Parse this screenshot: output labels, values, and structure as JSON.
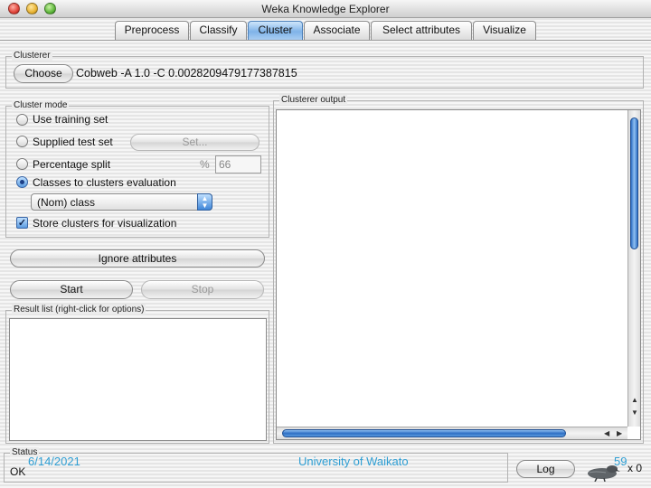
{
  "window": {
    "title": "Weka Knowledge Explorer"
  },
  "tabs": [
    {
      "label": "Preprocess",
      "active": false
    },
    {
      "label": "Classify",
      "active": false
    },
    {
      "label": "Cluster",
      "active": true
    },
    {
      "label": "Associate",
      "active": false
    },
    {
      "label": "Select attributes",
      "active": false
    },
    {
      "label": "Visualize",
      "active": false
    }
  ],
  "clusterer": {
    "title": "Clusterer",
    "choose_label": "Choose",
    "scheme": "Cobweb -A 1.0 -C 0.0028209479177387815"
  },
  "cluster_mode": {
    "title": "Cluster mode",
    "options": [
      {
        "label": "Use training set",
        "selected": false
      },
      {
        "label": "Supplied test set",
        "selected": false
      },
      {
        "label": "Percentage split",
        "selected": false
      },
      {
        "label": "Classes to clusters evaluation",
        "selected": true
      }
    ],
    "set_button": "Set...",
    "percent_symbol": "%",
    "percent_value": "66",
    "class_select": "(Nom) class",
    "store_clusters_label": "Store clusters for visualization",
    "store_clusters_checked": true
  },
  "buttons": {
    "ignore_attributes": "Ignore attributes",
    "start": "Start",
    "stop": "Stop"
  },
  "result_list": {
    "title": "Result list (right-click for options)"
  },
  "output": {
    "title": "Clusterer output"
  },
  "status": {
    "title": "Status",
    "text": "OK",
    "log_button": "Log",
    "count": "x 0"
  },
  "slide_footer": {
    "date": "6/14/2021",
    "institution": "University of Waikato",
    "page": "59"
  },
  "colors": {
    "accent_blue": "#3f86d8",
    "footer_text": "#2f9fd4"
  }
}
